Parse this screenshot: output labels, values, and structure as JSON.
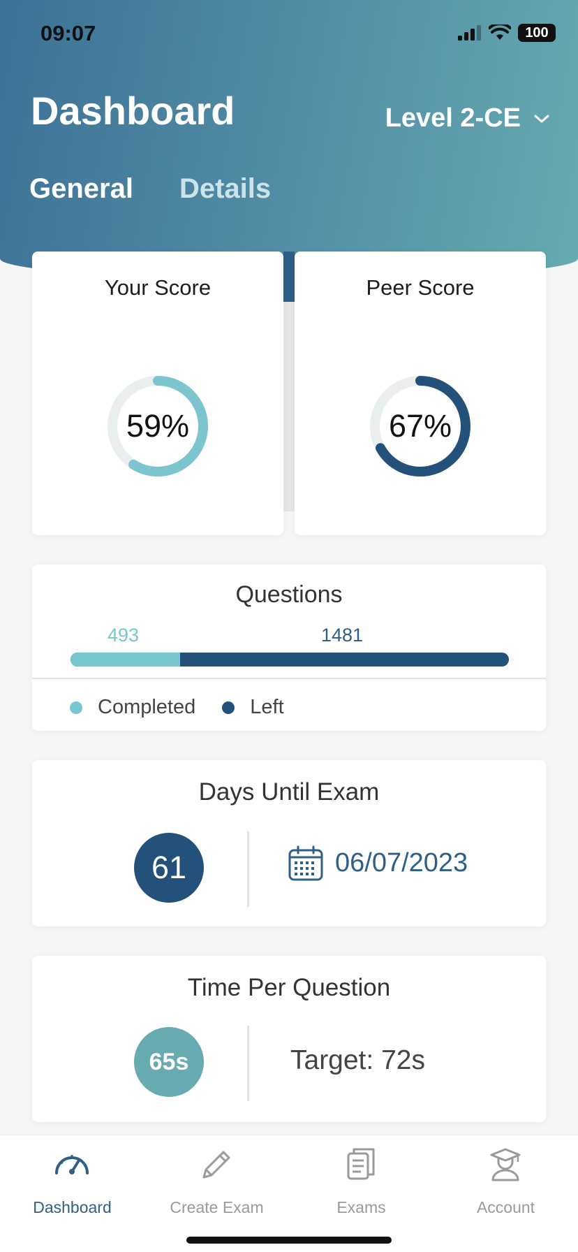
{
  "status_bar": {
    "time": "09:07",
    "battery": "100"
  },
  "header": {
    "title": "Dashboard",
    "level": "Level 2-CE",
    "tabs": [
      {
        "label": "General",
        "active": true
      },
      {
        "label": "Details",
        "active": false
      }
    ]
  },
  "your_score": {
    "title": "Your Score",
    "value_label": "59%",
    "percent": 59,
    "color": "#7cc5ce"
  },
  "peer_score": {
    "title": "Peer Score",
    "value_label": "67%",
    "percent": 67,
    "color": "#24517a"
  },
  "questions": {
    "title": "Questions",
    "completed": "493",
    "left": "1481",
    "legend_completed": "Completed",
    "legend_left": "Left",
    "completed_color": "#78c6cf",
    "left_color": "#24517a"
  },
  "days_until_exam": {
    "title": "Days Until Exam",
    "days": "61",
    "date": "06/07/2023"
  },
  "time_per_question": {
    "title": "Time Per Question",
    "value": "65s",
    "target": "Target: 72s"
  },
  "nav": [
    {
      "label": "Dashboard",
      "icon": "speedometer-icon",
      "active": true
    },
    {
      "label": "Create Exam",
      "icon": "pencil-icon",
      "active": false
    },
    {
      "label": "Exams",
      "icon": "documents-icon",
      "active": false
    },
    {
      "label": "Account",
      "icon": "graduate-icon",
      "active": false
    }
  ]
}
